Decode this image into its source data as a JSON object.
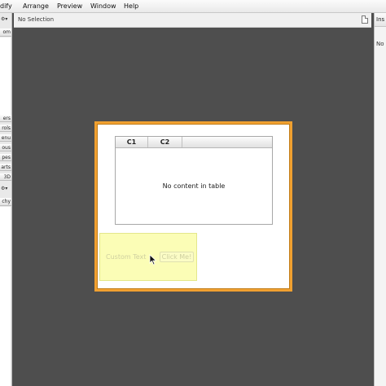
{
  "menubar": {
    "items": [
      "dify",
      "Arrange",
      "Preview",
      "Window",
      "Help"
    ]
  },
  "toolbar": {
    "selection_status": "No Selection",
    "document_icon": "document-icon"
  },
  "left_panel": {
    "gear_top": "⚙▾",
    "top_item": "om",
    "categories": [
      "ers",
      "rols",
      "enu",
      "ous",
      "pes",
      "arts",
      "3D"
    ],
    "gear_mid": "⚙▾",
    "hierarchy_label": "chy"
  },
  "right_panel": {
    "title": "Ins",
    "row_text": "No"
  },
  "canvas": {
    "table": {
      "columns": [
        "C1",
        "C2"
      ],
      "placeholder": "No content in table"
    },
    "custom_text": "Custom Text",
    "button_label": "Click Me!"
  },
  "colors": {
    "canvas_background": "#4e4e4e",
    "stage_border": "#f0a030",
    "selection_highlight": "#fbfdb6"
  }
}
